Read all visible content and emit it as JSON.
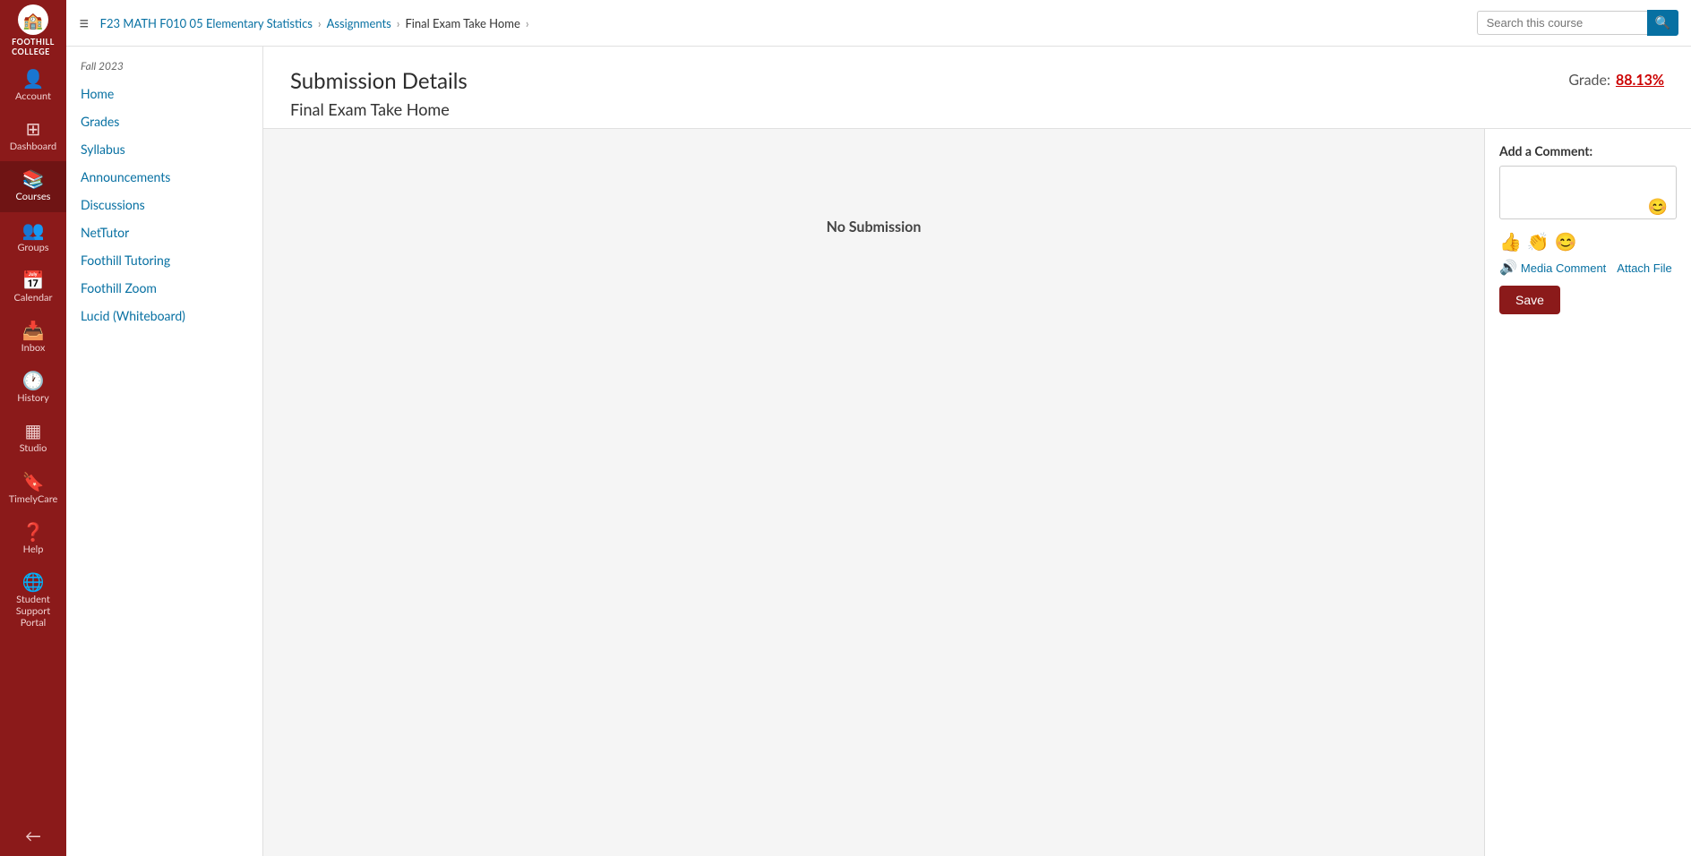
{
  "logo": {
    "icon": "🏫",
    "text": "FOOTHILL\nCOLLEGE"
  },
  "sidebar": {
    "items": [
      {
        "id": "account",
        "label": "Account",
        "icon": "👤"
      },
      {
        "id": "dashboard",
        "label": "Dashboard",
        "icon": "🏠"
      },
      {
        "id": "courses",
        "label": "Courses",
        "icon": "📚",
        "active": true
      },
      {
        "id": "groups",
        "label": "Groups",
        "icon": "👥"
      },
      {
        "id": "calendar",
        "label": "Calendar",
        "icon": "📅"
      },
      {
        "id": "inbox",
        "label": "Inbox",
        "icon": "📥"
      },
      {
        "id": "history",
        "label": "History",
        "icon": "🕐"
      },
      {
        "id": "studio",
        "label": "Studio",
        "icon": "⊞"
      },
      {
        "id": "timelycare",
        "label": "TimelyCare",
        "icon": "🔖"
      },
      {
        "id": "help",
        "label": "Help",
        "icon": "❓"
      },
      {
        "id": "student-support",
        "label": "Student Support Portal",
        "icon": "🌐"
      }
    ],
    "collapse_icon": "←"
  },
  "topbar": {
    "menu_icon": "≡",
    "breadcrumb": [
      {
        "label": "F23 MATH F010 05 Elementary Statistics",
        "link": true
      },
      {
        "label": "Assignments",
        "link": true
      },
      {
        "label": "Final Exam Take Home",
        "link": false
      }
    ],
    "search_placeholder": "Search this course"
  },
  "course_nav": {
    "semester": "Fall 2023",
    "items": [
      {
        "label": "Home"
      },
      {
        "label": "Grades"
      },
      {
        "label": "Syllabus"
      },
      {
        "label": "Announcements"
      },
      {
        "label": "Discussions"
      },
      {
        "label": "NetTutor"
      },
      {
        "label": "Foothill Tutoring"
      },
      {
        "label": "Foothill Zoom"
      },
      {
        "label": "Lucid (Whiteboard)"
      }
    ]
  },
  "page": {
    "title": "Submission Details",
    "assignment_name": "Final Exam Take Home",
    "grade_label": "Grade:",
    "grade_value": "88.13%",
    "no_submission_text": "No Submission"
  },
  "comment_panel": {
    "title": "Add a Comment:",
    "emoji_hint": "😊",
    "thumbs_up": "👍",
    "clap": "👏",
    "smiley": "😊",
    "media_comment_label": "Media Comment",
    "attach_file_label": "Attach File",
    "save_label": "Save"
  }
}
